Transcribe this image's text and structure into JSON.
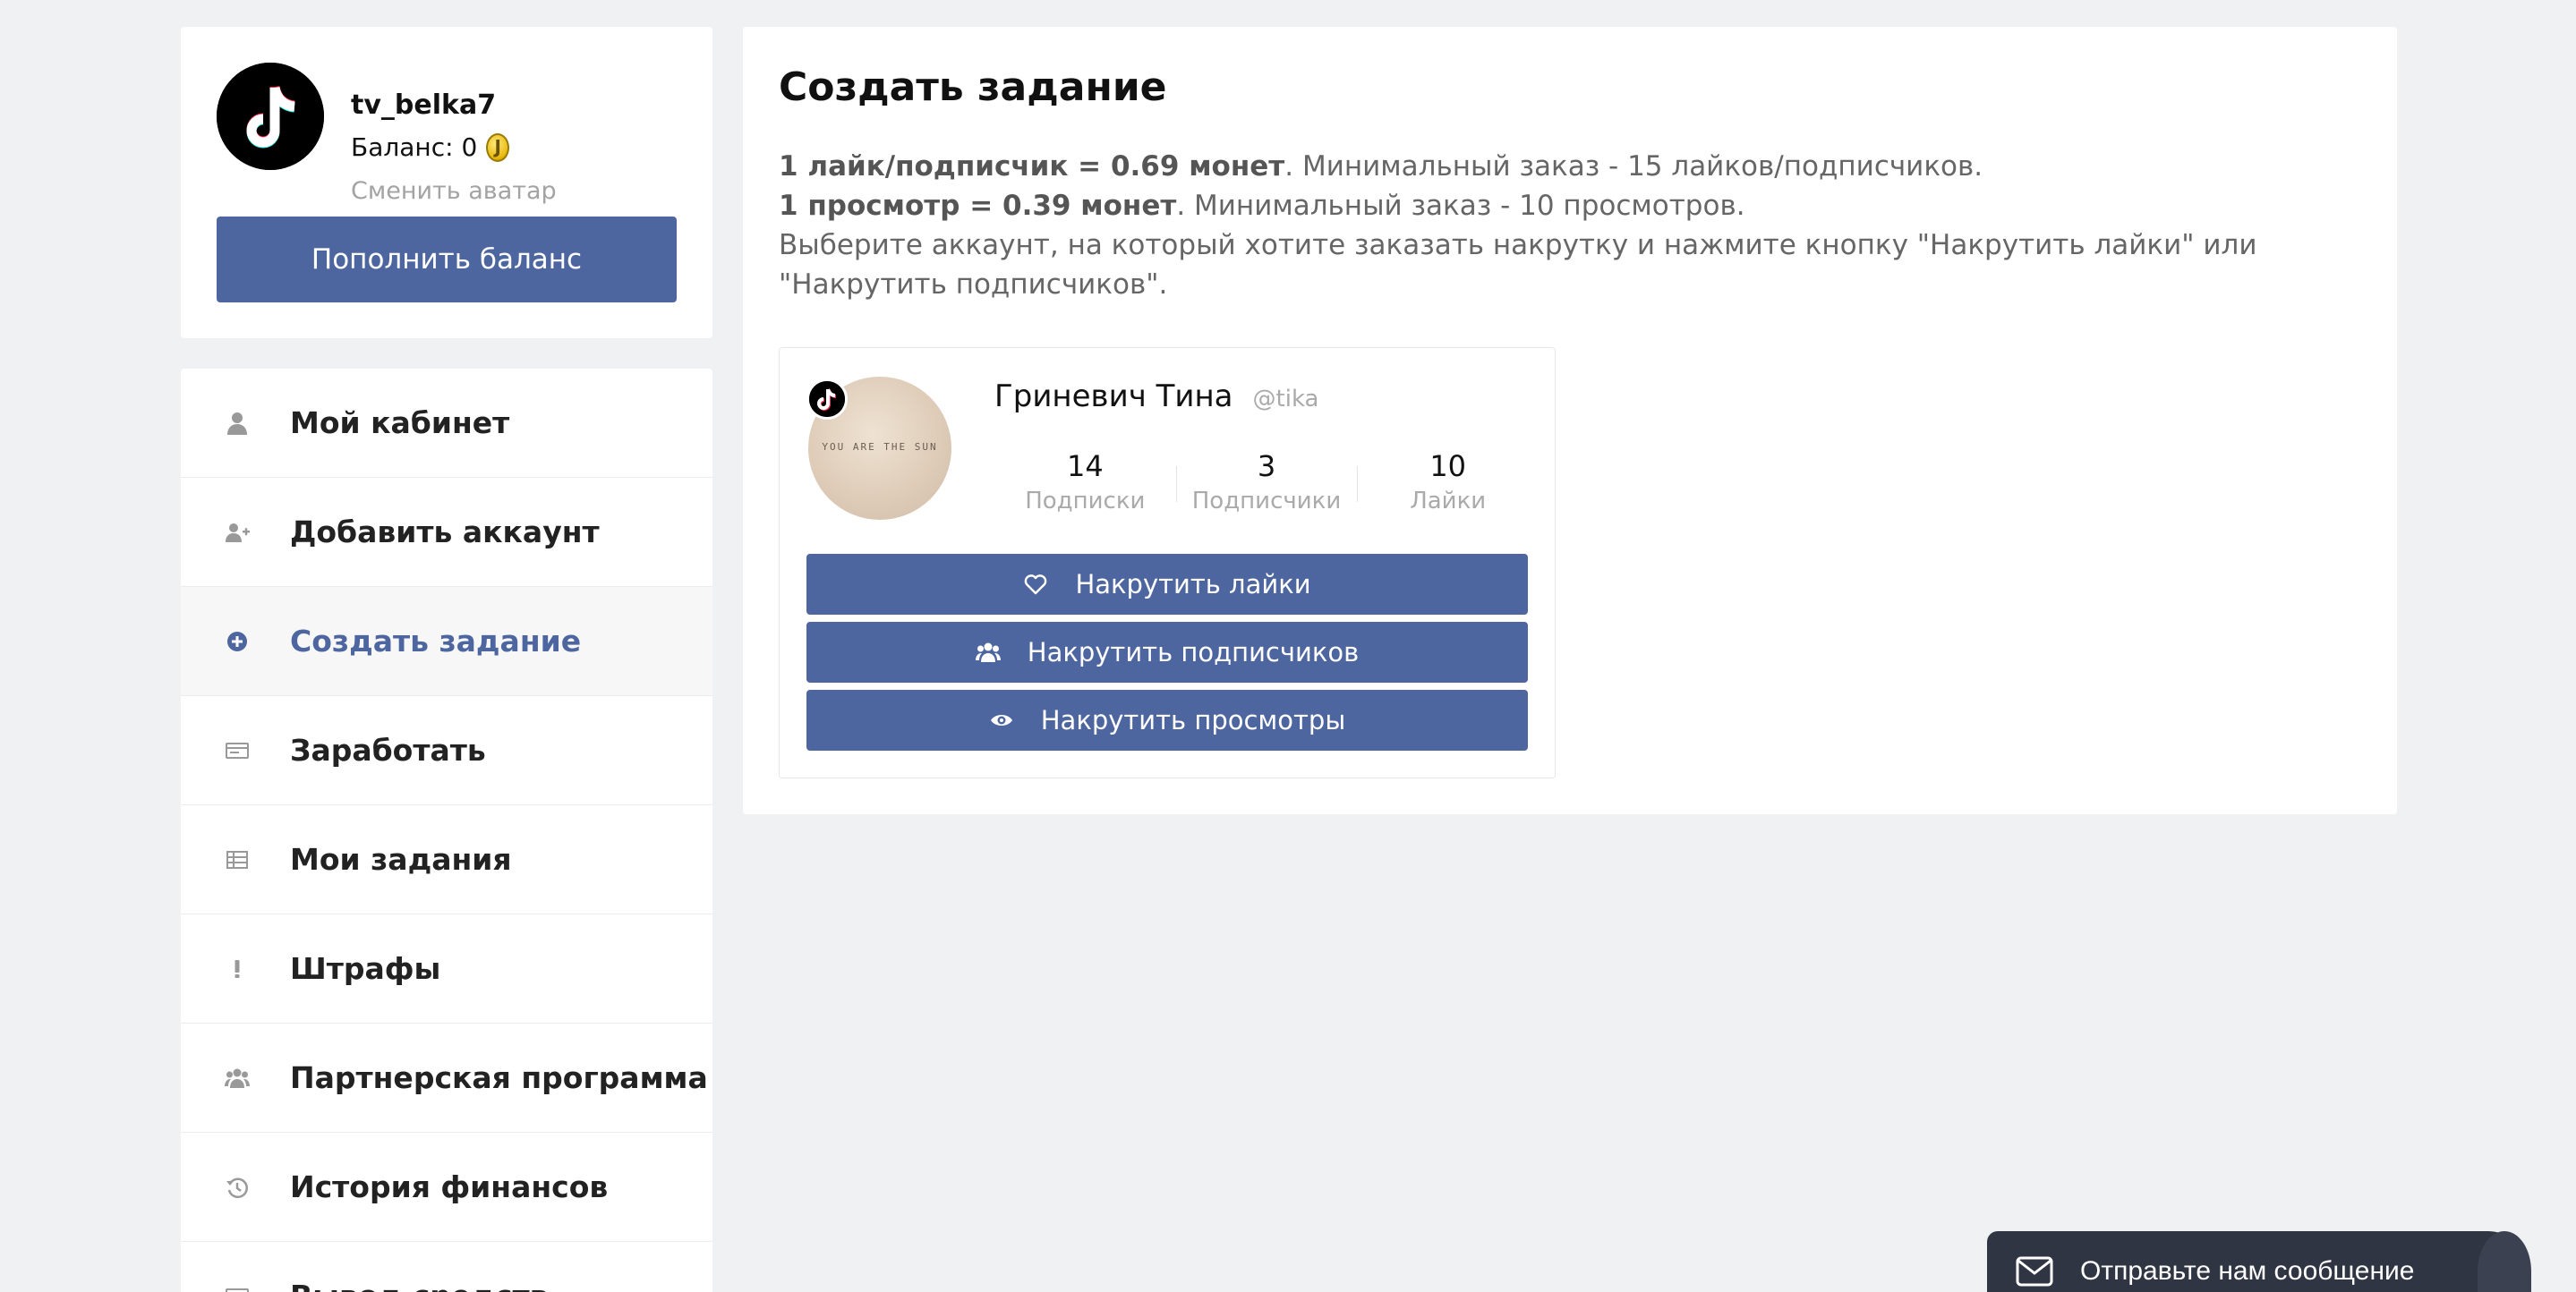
{
  "profile": {
    "username": "tv_belka7",
    "balance_label": "Баланс: 0",
    "change_avatar": "Сменить аватар",
    "topup_button": "Пополнить баланс"
  },
  "menu": {
    "items": [
      {
        "label": "Мой кабинет",
        "icon": "user-icon"
      },
      {
        "label": "Добавить аккаунт",
        "icon": "user-plus-icon"
      },
      {
        "label": "Создать задание",
        "icon": "plus-circle-icon",
        "active": true
      },
      {
        "label": "Заработать",
        "icon": "money-icon"
      },
      {
        "label": "Мои задания",
        "icon": "table-icon"
      },
      {
        "label": "Штрафы",
        "icon": "exclamation-icon"
      },
      {
        "label": "Партнерская программа",
        "icon": "users-icon"
      },
      {
        "label": "История финансов",
        "icon": "history-icon"
      },
      {
        "label": "Вывод средств",
        "icon": "wallet-icon"
      }
    ]
  },
  "main": {
    "title": "Создать задание",
    "info": {
      "line1_bold": "1 лайк/подписчик = 0.69 монет",
      "line1_rest": ". Минимальный заказ - 15 лайков/подписчиков.",
      "line2_bold": "1 просмотр = 0.39 монет",
      "line2_rest": ". Минимальный заказ - 10 просмотров.",
      "line3": "Выберите аккаунт, на который хотите заказать накрутку и нажмите кнопку \"Накрутить лайки\" или \"Накрутить подписчиков\"."
    },
    "account": {
      "photo_text": "YOU ARE THE SUN",
      "name": "Гриневич Тина",
      "handle": "@tika",
      "stats": [
        {
          "value": "14",
          "label": "Подписки"
        },
        {
          "value": "3",
          "label": "Подписчики"
        },
        {
          "value": "10",
          "label": "Лайки"
        }
      ],
      "buttons": {
        "likes": "Накрутить лайки",
        "subscribers": "Накрутить подписчиков",
        "views": "Накрутить просмотры"
      }
    }
  },
  "chat": {
    "label": "Отправьте нам сообщение"
  },
  "colors": {
    "accent": "#4e66a0",
    "page_bg": "#f0f1f3",
    "chat_bg": "#2f3542"
  }
}
